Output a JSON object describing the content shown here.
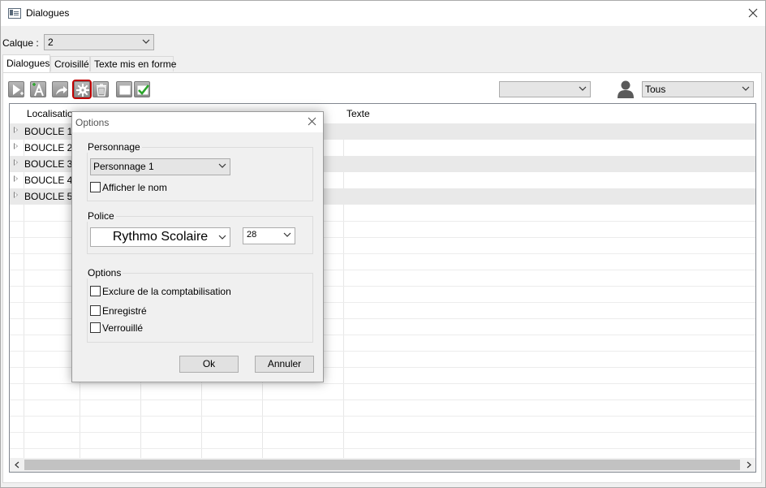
{
  "window": {
    "title": "Dialogues",
    "icon": "window-app-icon",
    "close_icon": "close-icon"
  },
  "calque": {
    "label": "Calque :",
    "value": "2"
  },
  "tabs": [
    {
      "label": "Dialogues",
      "active": true
    },
    {
      "label": "Croisillé",
      "active": false
    },
    {
      "label": "Texte mis en forme",
      "active": false
    }
  ],
  "toolbar": {
    "buttons": [
      "play-add-icon",
      "font-add-icon",
      "share-arrow-icon",
      "options-gear-icon",
      "trash-icon",
      "rectangle-icon",
      "checkbox-checked-icon"
    ],
    "selected": "options-gear-icon",
    "filter_value": "",
    "person_filter": "Tous"
  },
  "grid": {
    "columns": [
      "Localisation",
      "",
      "",
      "",
      "",
      "Texte"
    ],
    "rows": [
      "BOUCLE 1",
      "BOUCLE 2",
      "BOUCLE 3",
      "BOUCLE 4",
      "BOUCLE 5"
    ]
  },
  "dialog": {
    "title": "Options",
    "personnage": {
      "group_label": "Personnage",
      "selected": "Personnage 1",
      "show_name_label": "Afficher le nom",
      "show_name_checked": false
    },
    "police": {
      "group_label": "Police",
      "font": "Rythmo Scolaire",
      "size": "28"
    },
    "options": {
      "group_label": "Options",
      "exclude_label": "Exclure de la comptabilisation",
      "exclude_checked": false,
      "recorded_label": "Enregistré",
      "recorded_checked": false,
      "locked_label": "Verrouillé",
      "locked_checked": false
    },
    "ok_label": "Ok",
    "cancel_label": "Annuler"
  },
  "colors": {
    "selection_outline": "#c00000",
    "row_alt": "#e9e9e9",
    "check_green": "#2aa52a"
  }
}
